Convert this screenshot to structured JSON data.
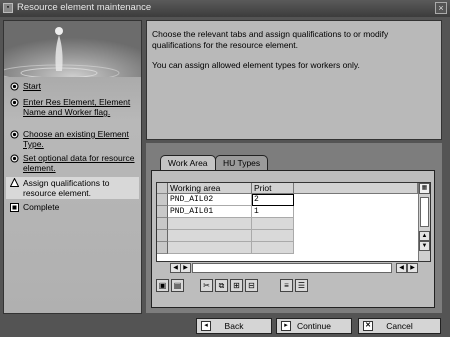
{
  "window": {
    "title": "Resource element maintenance"
  },
  "steps": [
    {
      "label": "Start",
      "icon": "radio-unfilled-icon"
    },
    {
      "label": "Enter Res Element, Element Name and Worker flag.",
      "icon": "radio-unfilled-icon"
    },
    {
      "label": "Choose an existing Element Type.",
      "icon": "radio-unfilled-icon"
    },
    {
      "label": "Set optional data for resource element.",
      "icon": "radio-unfilled-icon"
    },
    {
      "label": "Assign qualifications to resource element.",
      "icon": "triangle-current-icon"
    },
    {
      "label": "Complete",
      "icon": "square-filled-icon"
    }
  ],
  "info": {
    "line1": "Choose the relevant tabs and assign qualifications to or modify qualifications for the resource element.",
    "line2": "You can assign allowed element types for workers only."
  },
  "tabs": [
    {
      "label": "Work Area"
    },
    {
      "label": "HU Types"
    }
  ],
  "table": {
    "columns": [
      "Working area",
      "Priot"
    ],
    "rows": [
      {
        "area": "PND_AIL02",
        "prio": "2"
      },
      {
        "area": "PND_AIL01",
        "prio": "1"
      }
    ]
  },
  "buttons": {
    "back": "Back",
    "continue": "Continue",
    "cancel": "Cancel"
  }
}
